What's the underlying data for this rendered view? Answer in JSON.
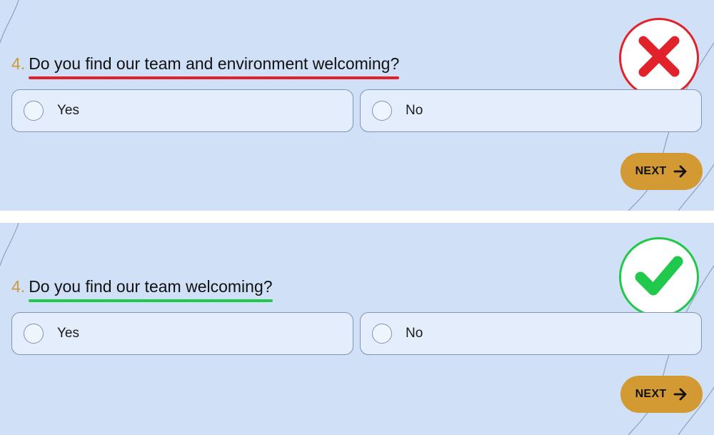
{
  "examples": [
    {
      "id": "bad",
      "question_number": "4.",
      "question_text": "Do you find our team and environment welcoming?",
      "underline_color": "#e2222b",
      "verdict_icon": "cross-icon",
      "verdict_color": "#e2222b",
      "options": [
        "Yes",
        "No"
      ],
      "next_label": "NEXT"
    },
    {
      "id": "good",
      "question_number": "4.",
      "question_text": "Do you find our team welcoming?",
      "underline_color": "#20c84b",
      "verdict_icon": "checkmark-icon",
      "verdict_color": "#20c84b",
      "options": [
        "Yes",
        "No"
      ],
      "next_label": "NEXT"
    }
  ],
  "colors": {
    "background": "#cfe0f7",
    "option_fill": "#e3edfb",
    "option_border": "#8194b6",
    "number_color": "#d09a3a",
    "next_button": "#d39a33"
  }
}
